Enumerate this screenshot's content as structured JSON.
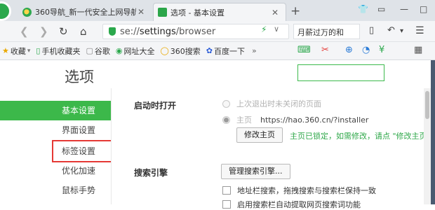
{
  "tabs": [
    {
      "title": "360导航_新一代安全上网导航",
      "active": false
    },
    {
      "title": "选项 - 基本设置",
      "active": true
    }
  ],
  "address": {
    "scheme": "se://",
    "host": "settings",
    "path": "/browser"
  },
  "search": {
    "value": "月薪过万的和"
  },
  "bookmarks": [
    {
      "icon": "star-icon",
      "label": "收藏"
    },
    {
      "icon": "phone-icon",
      "label": "手机收藏夹"
    },
    {
      "icon": "page-icon",
      "label": "谷歌"
    },
    {
      "icon": "globe-icon",
      "label": "网址大全"
    },
    {
      "icon": "360-icon",
      "label": "360搜索"
    },
    {
      "icon": "paw-icon",
      "label": "百度一下"
    }
  ],
  "bookmarks_more": "»",
  "page": {
    "title": "选项",
    "search_placeholder": ""
  },
  "sidebar": {
    "items": [
      {
        "label": "基本设置",
        "active": true
      },
      {
        "label": "界面设置",
        "active": false
      },
      {
        "label": "标签设置",
        "active": false
      },
      {
        "label": "优化加速",
        "active": false
      },
      {
        "label": "鼠标手势",
        "active": false
      }
    ]
  },
  "startup": {
    "label": "启动时打开",
    "option_restore": "上次退出时未关闭的页面",
    "option_home": "主页",
    "home_url": "https://hao.360.cn/?installer",
    "modify_button": "修改主页",
    "locked_note": "主页已锁定，如需修改，请点 \"修改主页"
  },
  "search_engine": {
    "label": "搜索引擎",
    "manage_button": "管理搜索引擎...",
    "check1": "地址栏搜索，拖拽搜索与搜索栏保持一致",
    "check2": "启用搜索栏自动提取网页搜索词功能"
  },
  "colors": {
    "accent": "#3cb84a",
    "highlight": "#e53935"
  }
}
